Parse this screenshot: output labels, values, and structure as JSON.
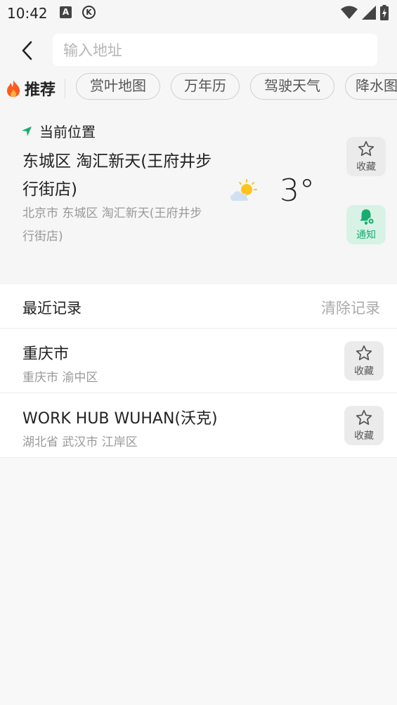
{
  "status_bar": {
    "time": "10:42",
    "icon_a": "A",
    "icon_k": "K"
  },
  "search": {
    "placeholder": "输入地址",
    "value": ""
  },
  "tags": {
    "recommend_label": "推荐",
    "items": [
      "赏叶地图",
      "万年历",
      "驾驶天气",
      "降水图"
    ]
  },
  "current_location": {
    "header": "当前位置",
    "name": "东城区 淘汇新天(王府井步行街店)",
    "address": "北京市 东城区 淘汇新天(王府井步行街店)",
    "temperature": "3°",
    "weather_icon": "partly-cloudy-icon",
    "favorite_label": "收藏",
    "notify_label": "通知"
  },
  "history": {
    "title": "最近记录",
    "clear_label": "清除记录",
    "items": [
      {
        "title": "重庆市",
        "subtitle": "重庆市 渝中区",
        "favorite_label": "收藏"
      },
      {
        "title": "WORK HUB WUHAN(沃克)",
        "subtitle": "湖北省 武汉市 江岸区",
        "favorite_label": "收藏"
      }
    ]
  },
  "colors": {
    "accent_green": "#1aab6e",
    "background": "#f6f6f6",
    "flame_orange": "#ff5a1f"
  }
}
